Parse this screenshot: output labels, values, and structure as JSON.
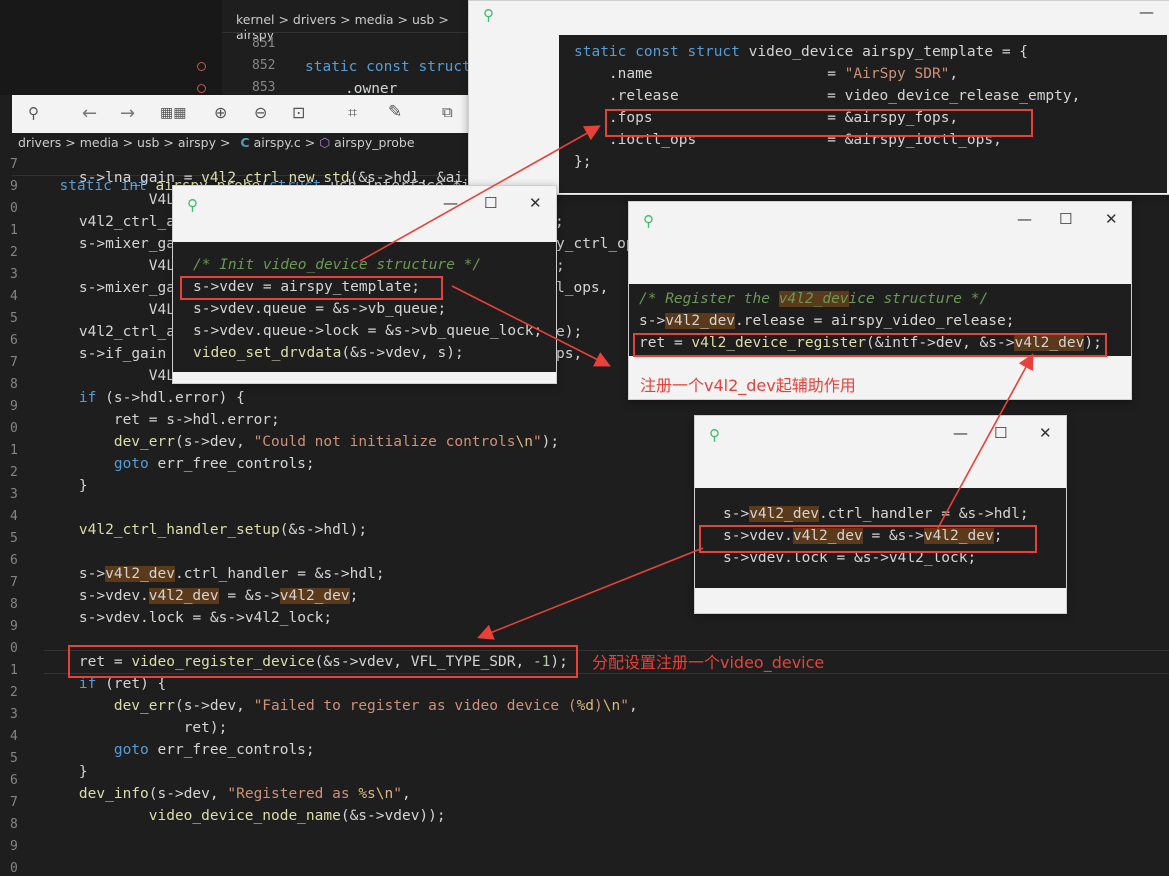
{
  "editor": {
    "breadcrumb_top": "kernel > drivers > media > usb > airspy",
    "breadcrumb_main": {
      "path": "drivers > media > usb > airspy >",
      "file": "airspy.c",
      "symbol": "airspy_probe"
    },
    "top_lines": {
      "n851": "851",
      "n852": "852",
      "n853": "853",
      "l852": "static const struct",
      "l853": ".owner"
    },
    "probe_line": "static int airspy_probe(struct usb_interface *int",
    "lines": [
      "s->lna_gain = v4l2_ctrl_new_std(&s->hdl, &ai",
      "        V4L",
      "v4l2_ctrl_a",
      "s->mixer_ga",
      "        V4L",
      "s->mixer_ga",
      "        V4L",
      "v4l2_ctrl_a",
      "s->if_gain",
      "        V4L",
      "if (s->hdl.error) {",
      "    ret = s->hdl.error;",
      "    dev_err(s->dev, \"Could not initialize controls\\n\");",
      "    goto err_free_controls;",
      "}",
      "",
      "v4l2_ctrl_handler_setup(&s->hdl);",
      "",
      "s->v4l2_dev.ctrl_handler = &s->hdl;",
      "s->vdev.v4l2_dev = &s->v4l2_dev;",
      "s->vdev.lock = &s->v4l2_lock;",
      "",
      "ret = video_register_device(&s->vdev, VFL_TYPE_SDR, -1);",
      "if (ret) {",
      "    dev_err(s->dev, \"Failed to register as video device (%d)\\n\",",
      "            ret);",
      "    goto err_free_controls;",
      "}",
      "dev_info(s->dev, \"Registered as %s\\n\",",
      "        video_device_node_name(&s->vdev));"
    ],
    "right_fragments": {
      "f1": ";",
      "f2": "y_ctrl_op",
      "f3": ";",
      "f4": "l_ops,",
      "f5": "e);",
      "f6": "ps,"
    },
    "gutter_numbers": [
      "7",
      "9",
      "0",
      "1",
      "2",
      "3",
      "4",
      "5",
      "6",
      "7",
      "8",
      "9",
      "0",
      "1",
      "2",
      "3",
      "4",
      "5",
      "6",
      "7",
      "8",
      "9",
      "0",
      "1",
      "2",
      "3",
      "4",
      "5",
      "6",
      "7",
      "8",
      "9",
      "0"
    ]
  },
  "popup_template": {
    "lines": [
      "static const struct video_device airspy_template = {",
      "    .name                    = \"AirSpy SDR\",",
      "    .release                 = video_device_release_empty,",
      "    .fops                    = &airspy_fops,",
      "    .ioctl_ops               = &airspy_ioctl_ops,",
      "};"
    ]
  },
  "popup_init": {
    "lines": [
      "/* Init video_device structure */",
      "s->vdev = airspy_template;",
      "s->vdev.queue = &s->vb_queue;",
      "s->vdev.queue->lock = &s->vb_queue_lock;",
      "video_set_drvdata(&s->vdev, s);"
    ]
  },
  "popup_register": {
    "lines": [
      "/* Register the v4l2_device structure */",
      "s->v4l2_dev.release = airspy_video_release;",
      "ret = v4l2_device_register(&intf->dev, &s->v4l2_dev);"
    ],
    "note": "注册一个v4l2_dev起辅助作用"
  },
  "popup_ctrl": {
    "lines": [
      "s->v4l2_dev.ctrl_handler = &s->hdl;",
      "s->vdev.v4l2_dev = &s->v4l2_dev;",
      "s->vdev.lock = &s->v4l2_lock;"
    ]
  },
  "annotation_main": "分配设置注册一个video_device",
  "window_buttons": {
    "minimize": "—",
    "maximize": "☐",
    "close": "✕"
  },
  "colors": {
    "annotation": "#e8413a",
    "pin": "#3dbb6c",
    "editor_bg": "#1e1e1e"
  }
}
